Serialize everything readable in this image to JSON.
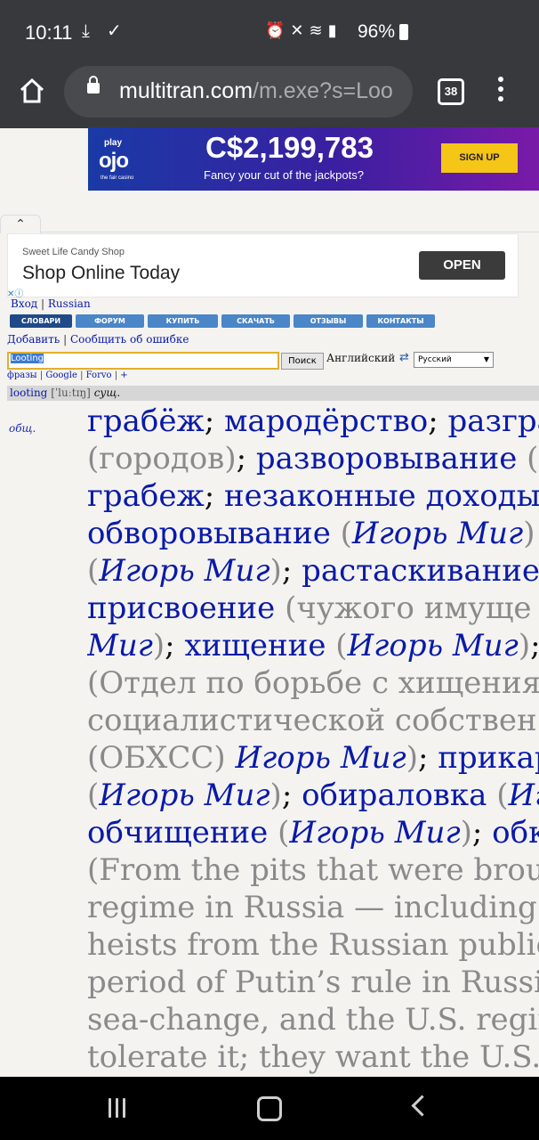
{
  "status_bar": {
    "time": "10:11",
    "battery": "96%"
  },
  "browser": {
    "url_host": "multitran.com",
    "url_path": "/m.exe?s=Loo",
    "tab_count": "38"
  },
  "ad_banner": {
    "logo_top": "play",
    "logo": "ojo",
    "logo_sub": "the fair casino",
    "amount": "C$2,199,783",
    "tagline": "Fancy your cut of the jackpots?",
    "cta": "SIGN UP"
  },
  "ad_candy": {
    "sponsor": "Sweet Life Candy Shop",
    "headline": "Shop Online Today",
    "cta": "OPEN"
  },
  "top_links": {
    "login": "Вход",
    "lang": "Russian"
  },
  "nav": [
    {
      "label": "СЛОВАРИ"
    },
    {
      "label": "ФОРУМ"
    },
    {
      "label": "КУПИТЬ"
    },
    {
      "label": "СКАЧАТЬ"
    },
    {
      "label": "ОТЗЫВЫ"
    },
    {
      "label": "КОНТАКТЫ"
    }
  ],
  "actions": {
    "add": "Добавить",
    "report": "Сообщить об ошибке"
  },
  "search": {
    "value": "Looting",
    "button": "Поиск",
    "lang_from": "Английский",
    "lang_to": "Русский"
  },
  "sublinks": {
    "phrases": "фразы",
    "google": "Google",
    "forvo": "Forvo",
    "plus": "+"
  },
  "entry": {
    "headword": "looting",
    "transcription": "[ˈluːtɪŋ]",
    "pos": "сущ.",
    "subject": "общ."
  },
  "translations": [
    {
      "text": "грабёж",
      "type": "w"
    },
    {
      "text": "; ",
      "type": "p"
    },
    {
      "text": "мародёрство",
      "type": "w"
    },
    {
      "text": "; ",
      "type": "p"
    },
    {
      "text": "разгра",
      "type": "w"
    },
    {
      "text": "\n",
      "type": "br"
    },
    {
      "text": "(городов)",
      "type": "g"
    },
    {
      "text": "; ",
      "type": "p"
    },
    {
      "text": "разворовывание",
      "type": "w"
    },
    {
      "text": " (",
      "type": "g"
    },
    {
      "text": "\n",
      "type": "br"
    },
    {
      "text": "грабеж",
      "type": "w"
    },
    {
      "text": "; ",
      "type": "p"
    },
    {
      "text": "незаконные доходы",
      "type": "w"
    },
    {
      "text": "\n",
      "type": "br"
    },
    {
      "text": "обворовывание",
      "type": "w"
    },
    {
      "text": " (",
      "type": "g"
    },
    {
      "text": "Игорь Миг",
      "type": "a"
    },
    {
      "text": ")",
      "type": "g"
    },
    {
      "text": "\n",
      "type": "br"
    },
    {
      "text": "(",
      "type": "g"
    },
    {
      "text": "Игорь Миг",
      "type": "a"
    },
    {
      "text": ")",
      "type": "g"
    },
    {
      "text": "; ",
      "type": "p"
    },
    {
      "text": "растаскивание",
      "type": "w"
    },
    {
      "text": "\n",
      "type": "br"
    },
    {
      "text": "присвоение",
      "type": "w"
    },
    {
      "text": " (чужого имуще",
      "type": "g"
    },
    {
      "text": "\n",
      "type": "br"
    },
    {
      "text": "Миг",
      "type": "a"
    },
    {
      "text": ")",
      "type": "g"
    },
    {
      "text": "; ",
      "type": "p"
    },
    {
      "text": "хищение",
      "type": "w"
    },
    {
      "text": " (",
      "type": "g"
    },
    {
      "text": "Игорь Миг",
      "type": "a"
    },
    {
      "text": ")",
      "type": "g"
    },
    {
      "text": ";",
      "type": "p"
    },
    {
      "text": "\n",
      "type": "br"
    },
    {
      "text": "(Отдел по борьбе с хищения",
      "type": "g"
    },
    {
      "text": "\n",
      "type": "br"
    },
    {
      "text": "социалистической собствен",
      "type": "g"
    },
    {
      "text": "\n",
      "type": "br"
    },
    {
      "text": "(ОБХСС) ",
      "type": "g"
    },
    {
      "text": "Игорь Миг",
      "type": "a"
    },
    {
      "text": ")",
      "type": "g"
    },
    {
      "text": "; ",
      "type": "p"
    },
    {
      "text": "прикарм",
      "type": "w"
    },
    {
      "text": "\n",
      "type": "br"
    },
    {
      "text": "(",
      "type": "g"
    },
    {
      "text": "Игорь Миг",
      "type": "a"
    },
    {
      "text": ")",
      "type": "g"
    },
    {
      "text": "; ",
      "type": "p"
    },
    {
      "text": "обираловка",
      "type": "w"
    },
    {
      "text": " (",
      "type": "g"
    },
    {
      "text": "Иг",
      "type": "a"
    },
    {
      "text": "\n",
      "type": "br"
    },
    {
      "text": "обчищение",
      "type": "w"
    },
    {
      "text": " (",
      "type": "g"
    },
    {
      "text": "Игорь Миг",
      "type": "a"
    },
    {
      "text": ")",
      "type": "g"
    },
    {
      "text": "; ",
      "type": "p"
    },
    {
      "text": "обк",
      "type": "w"
    },
    {
      "text": "\n",
      "type": "br"
    },
    {
      "text": "(From the pits that were broug",
      "type": "g"
    },
    {
      "text": "\n",
      "type": "br"
    },
    {
      "text": "regime in Russia — including",
      "type": "g"
    },
    {
      "text": "\n",
      "type": "br"
    },
    {
      "text": "heists from the Russian public",
      "type": "g"
    },
    {
      "text": "\n",
      "type": "br"
    },
    {
      "text": "period of Putin’s rule in Russia",
      "type": "g"
    },
    {
      "text": "\n",
      "type": "br"
    },
    {
      "text": "sea-change, and the U.S. regim",
      "type": "g"
    },
    {
      "text": "\n",
      "type": "br"
    },
    {
      "text": "tolerate it; they want the U.S. e",
      "type": "g"
    }
  ]
}
